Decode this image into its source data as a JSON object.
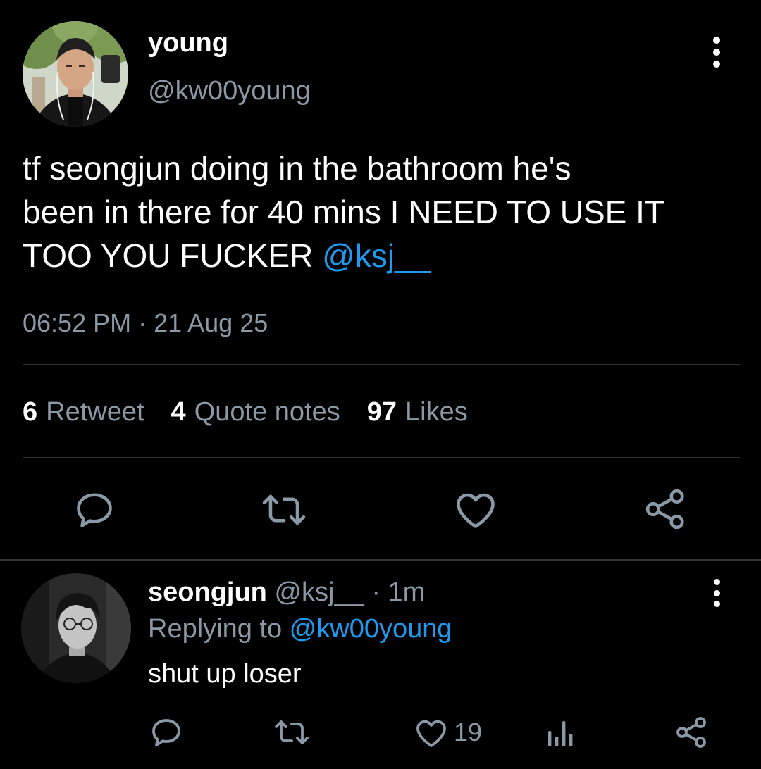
{
  "tweet": {
    "display_name": "young",
    "handle": "@kw00young",
    "text_before_mention": "tf seongjun doing in the bathroom he's\nbeen in there for 40 mins I NEED TO USE IT\nTOO YOU FUCKER ",
    "mention": "@ksj__",
    "timestamp": "06:52 PM · 21 Aug 25",
    "stats": [
      {
        "count": "6",
        "label": "Retweet"
      },
      {
        "count": "4",
        "label": "Quote notes"
      },
      {
        "count": "97",
        "label": "Likes"
      }
    ],
    "actions": [
      "reply-icon",
      "retweet-icon",
      "like-icon",
      "share-icon"
    ]
  },
  "reply": {
    "display_name": "seongjun",
    "handle": "@ksj__",
    "separator": "·",
    "time": "1m",
    "replying_prefix": "Replying to ",
    "replying_handle": "@kw00young",
    "text": "shut up loser",
    "like_count": "19",
    "actions": [
      "reply-icon",
      "retweet-icon",
      "like-icon",
      "analytics-icon",
      "share-icon"
    ]
  },
  "colors": {
    "background": "#000000",
    "text_primary": "#ffffff",
    "text_secondary": "#8b98a5",
    "accent_link": "#1d9bf0",
    "divider": "#2f3336"
  }
}
